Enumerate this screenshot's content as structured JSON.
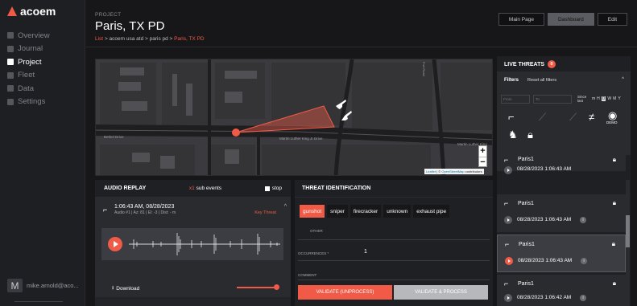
{
  "brand": {
    "name": "acoem",
    "accent": "#f05a46"
  },
  "sidebar": {
    "items": [
      {
        "label": "Overview",
        "icon": "grid-icon"
      },
      {
        "label": "Journal",
        "icon": "bell-icon"
      },
      {
        "label": "Project",
        "icon": "network-icon",
        "active": true
      },
      {
        "label": "Fleet",
        "icon": "sensor-icon"
      },
      {
        "label": "Data",
        "icon": "folder-icon"
      },
      {
        "label": "Settings",
        "icon": "gear-icon"
      }
    ],
    "user": {
      "initial": "M",
      "name": "mike.arnold@aco..."
    }
  },
  "header": {
    "kicker": "PROJECT",
    "title": "Paris, TX PD",
    "crumbs": {
      "list": "List",
      "sep": ">",
      "client": "acoem usa atd",
      "site": "paris pd",
      "current": "Paris, TX PD"
    },
    "buttons": {
      "main": "Main Page",
      "dashboard": "Dashboard",
      "edit": "Edit"
    }
  },
  "map": {
    "streets": {
      "s1": "Martin Luther King Jr Drive",
      "s2": "Martin Luther King",
      "s3": "Bethel Drive",
      "s4": "Fort Road"
    },
    "zoom_in": "+",
    "zoom_out": "−",
    "attribution": {
      "leaflet": "Leaflet",
      "sep": " | © ",
      "osm": "OpenStreetMap",
      "tail": " contributors"
    }
  },
  "audio": {
    "title": "AUDIO REPLAY",
    "sub_count": "x1",
    "sub_label": "sub events",
    "stop": "stop",
    "event": {
      "time": "1:06:43 AM, 08/28/2023",
      "info": "Audio #1 | Az: 81 | El: -3 | Dist: - m",
      "threat": "Key Threat"
    },
    "download": "Download"
  },
  "threat": {
    "title": "THREAT IDENTIFICATION",
    "chips": [
      "gunshot",
      "sniper",
      "firecracker",
      "unknown",
      "exhaust pipe"
    ],
    "other_label": "OTHER",
    "occ_label": "OCCURRENCES *",
    "occ_value": "1",
    "comment_label": "COMMENT",
    "btn_validate": "VALIDATE (UNPROCESS)",
    "btn_process": "VALIDATE & PROCESS"
  },
  "live": {
    "title": "LIVE THREATS",
    "count": "0",
    "filters": "Filters",
    "reset": "Reset all filters",
    "from": "From",
    "to": "To",
    "since": "Since",
    "last": "last",
    "periods": [
      "m",
      "H",
      "D",
      "W",
      "M",
      "Y"
    ],
    "selected_period": "D",
    "demo": "DEMO",
    "cards": [
      {
        "name": "Paris1",
        "date": "08/28/2023 1:06:43 AM"
      },
      {
        "name": "Paris1",
        "date": "08/28/2023 1:06:43 AM"
      },
      {
        "name": "Paris1",
        "date": "08/28/2023 1:06:43 AM",
        "selected": true
      },
      {
        "name": "Paris1",
        "date": "08/28/2023 1:06:42 AM"
      }
    ]
  }
}
